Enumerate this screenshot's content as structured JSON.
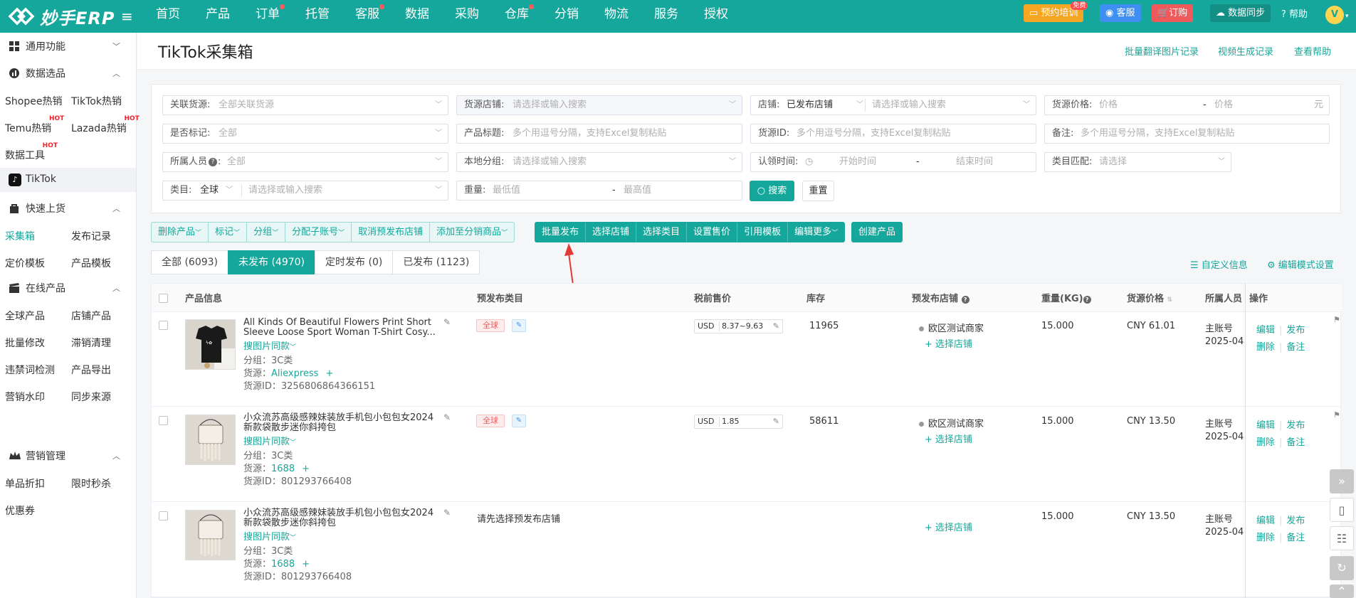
{
  "brand": {
    "name": "妙手ERP"
  },
  "nav": {
    "items": [
      {
        "label": "首页",
        "dot": false
      },
      {
        "label": "产品",
        "dot": false
      },
      {
        "label": "订单",
        "dot": true
      },
      {
        "label": "托管",
        "dot": false
      },
      {
        "label": "客服",
        "dot": true
      },
      {
        "label": "数据",
        "dot": false
      },
      {
        "label": "采购",
        "dot": false
      },
      {
        "label": "仓库",
        "dot": true
      },
      {
        "label": "分销",
        "dot": false
      },
      {
        "label": "物流",
        "dot": false
      },
      {
        "label": "服务",
        "dot": false
      },
      {
        "label": "授权",
        "dot": false
      }
    ],
    "training": "预约培训",
    "free_badge": "免费",
    "service": "客服",
    "subscribe": "订购",
    "sync": "数据同步",
    "help": "帮助",
    "avatar_letter": "V"
  },
  "sidebar": {
    "groups": [
      {
        "label": "通用功能",
        "icon": "grid-icon",
        "chev": "﹀"
      },
      {
        "label": "数据选品",
        "icon": "data-icon",
        "chev": "︿"
      },
      {
        "label": "快速上货",
        "icon": "bag-icon",
        "chev": "︿"
      },
      {
        "label": "在线产品",
        "icon": "clapper-icon",
        "chev": "︿"
      },
      {
        "label": "营销管理",
        "icon": "crown-icon",
        "chev": "︿"
      }
    ],
    "data_items": [
      "Shopee热销",
      "TikTok热销",
      "Temu热销",
      "Lazada热销",
      "数据工具"
    ],
    "hot": "HOT",
    "tiktok": "TikTok",
    "quick_items": [
      "采集箱",
      "发布记录",
      "定价模板",
      "产品模板"
    ],
    "online_items": [
      "全球产品",
      "店铺产品",
      "批量修改",
      "滞销清理",
      "违禁词检测",
      "产品导出",
      "营销水印",
      "同步来源"
    ],
    "marketing_items": [
      "单品折扣",
      "限时秒杀",
      "优惠券"
    ]
  },
  "page": {
    "title": "TikTok采集箱",
    "links": [
      "批量翻译图片记录",
      "视频生成记录",
      "查看帮助"
    ]
  },
  "filters": {
    "related_source": {
      "label": "关联货源:",
      "placeholder": "全部关联货源"
    },
    "source_shop": {
      "label": "货源店铺:",
      "placeholder": "请选择或输入搜索"
    },
    "shop": {
      "label": "店铺:",
      "value": "已发布店铺",
      "placeholder": "请选择或输入搜索"
    },
    "source_price": {
      "label": "货源价格:",
      "min": "价格",
      "dash": "-",
      "max": "价格",
      "unit": "元"
    },
    "marked": {
      "label": "是否标记:",
      "value": "全部"
    },
    "product_title": {
      "label": "产品标题:",
      "placeholder": "多个用逗号分隔，支持Excel复制粘贴"
    },
    "source_id": {
      "label": "货源ID:",
      "placeholder": "多个用逗号分隔，支持Excel复制粘贴"
    },
    "remark": {
      "label": "备注:",
      "placeholder": "多个用逗号分隔，支持Excel复制粘贴"
    },
    "owner": {
      "label": "所属人员",
      "value": "全部"
    },
    "local_group": {
      "label": "本地分组:",
      "placeholder": "请选择或输入搜索"
    },
    "claim_time": {
      "label": "认领时间:",
      "start": "开始时间",
      "dash": "-",
      "end": "结束时间"
    },
    "category_match": {
      "label": "类目匹配:",
      "placeholder": "请选择"
    },
    "category": {
      "label": "类目:",
      "value": "全球",
      "placeholder": "请选择或输入搜索"
    },
    "weight": {
      "label": "重量:",
      "min": "最低值",
      "dash": "-",
      "max": "最高值"
    },
    "search": "搜索",
    "reset": "重置"
  },
  "actions": {
    "light": [
      "删除产品",
      "标记",
      "分组",
      "分配子账号",
      "取消预发布店铺",
      "添加至分销商品"
    ],
    "solid": [
      "批量发布",
      "选择店铺",
      "选择类目",
      "设置售价",
      "引用模板",
      "编辑更多"
    ],
    "create": "创建产品"
  },
  "tabs": [
    "全部 (6093)",
    "未发布 (4970)",
    "定时发布 (0)",
    "已发布 (1123)"
  ],
  "tab_active": 1,
  "custom_info": "自定义信息",
  "edit_mode": "编辑模式设置",
  "table": {
    "headers": [
      "产品信息",
      "预发布类目",
      "税前售价",
      "库存",
      "预发布店铺",
      "重量(KG)",
      "货源价格",
      "所属人员",
      "操作"
    ],
    "rows": [
      {
        "title": "All Kinds Of Beautiful Flowers Print Short Sleeve Loose Sport Woman T-Shirt Cosy...",
        "same_image": "搜图片同款",
        "group": "分组：3C类",
        "source_label": "货源：",
        "source": "Aliexpress",
        "source_id": "货源ID：3256806864366151",
        "category_tag": "全球",
        "currency": "USD",
        "price": "8.37~9.63",
        "stock": "11965",
        "shop": "欧区测试商家",
        "select_shop": "选择店铺",
        "weight": "15.000",
        "source_price": "CNY 61.01",
        "owner": "主账号",
        "date": "2025-04",
        "op1": "编辑",
        "op2": "发布",
        "op3": "删除",
        "op4": "备注",
        "thumb": "tshirt"
      },
      {
        "title": "小众流苏高级感辣妹装放手机包小包包女2024新款袋散步迷你斜挎包",
        "same_image": "搜图片同款",
        "group": "分组：3C类",
        "source_label": "货源：",
        "source": "1688",
        "source_id": "货源ID：801293766408",
        "category_tag": "全球",
        "currency": "USD",
        "price": "1.85",
        "stock": "58611",
        "shop": "欧区测试商家",
        "select_shop": "选择店铺",
        "weight": "15.000",
        "source_price": "CNY 13.50",
        "owner": "主账号",
        "date": "2025-04",
        "op1": "编辑",
        "op2": "发布",
        "op3": "删除",
        "op4": "备注",
        "thumb": "bag"
      },
      {
        "title": "小众流苏高级感辣妹装放手机包小包包女2024新款袋散步迷你斜挎包",
        "same_image": "搜图片同款",
        "group": "分组：3C类",
        "source_label": "货源：",
        "source": "1688",
        "source_id": "货源ID：801293766408",
        "placeholder_category": "请先选择预发布店铺",
        "select_shop": "选择店铺",
        "weight": "15.000",
        "source_price": "CNY 13.50",
        "owner": "主账号",
        "date": "2025-04",
        "op1": "编辑",
        "op2": "发布",
        "op3": "删除",
        "op4": "备注",
        "thumb": "bag"
      }
    ]
  },
  "colors": {
    "primary": "#15a79b",
    "red": "#f05a5a",
    "orange": "#f5a623",
    "blue": "#3f8ff2"
  }
}
